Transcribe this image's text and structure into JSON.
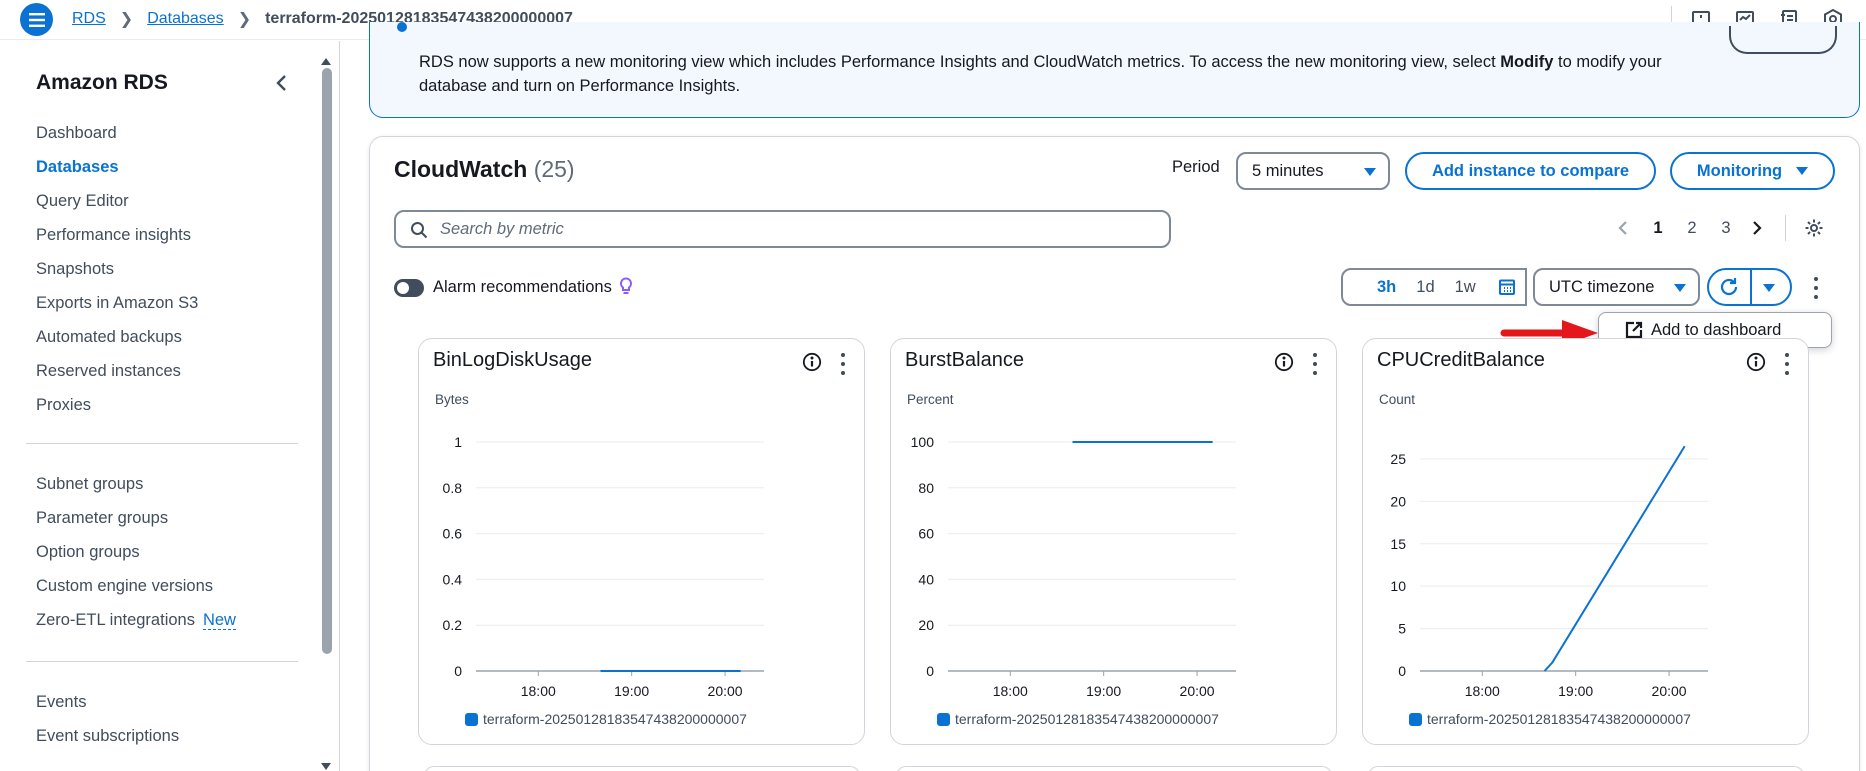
{
  "breadcrumb": {
    "items": [
      "RDS",
      "Databases"
    ],
    "current": "terraform-20250128183547438200000007"
  },
  "sidebar": {
    "title": "Amazon RDS",
    "group1": [
      "Dashboard",
      "Databases",
      "Query Editor",
      "Performance insights",
      "Snapshots",
      "Exports in Amazon S3",
      "Automated backups",
      "Reserved instances",
      "Proxies"
    ],
    "active": "Databases",
    "group2": [
      "Subnet groups",
      "Parameter groups",
      "Option groups",
      "Custom engine versions",
      "Zero-ETL integrations"
    ],
    "new_badge": "New",
    "group3": [
      "Events",
      "Event subscriptions"
    ]
  },
  "banner": {
    "text_before": "RDS now supports a new monitoring view which includes Performance Insights and CloudWatch metrics. To access the new monitoring view, select ",
    "text_bold": "Modify",
    "text_after": " to modify your database and turn on Performance Insights."
  },
  "cloudwatch": {
    "title": "CloudWatch",
    "count": "(25)",
    "period_label": "Period",
    "period_value": "5 minutes",
    "add_compare": "Add instance to compare",
    "monitoring": "Monitoring",
    "search_placeholder": "Search by metric",
    "pages": [
      "1",
      "2",
      "3"
    ],
    "current_page": "1",
    "alarm_label": "Alarm recommendations",
    "ranges": [
      "3h",
      "1d",
      "1w"
    ],
    "selected_range": "3h",
    "timezone": "UTC timezone",
    "popover_label": "Add to dashboard"
  },
  "colors": {
    "accent": "#0972d3",
    "series": "#0972d3",
    "annotation_arrow": "#e3171c",
    "alarm_bulb": "#8b5cf6"
  },
  "chart_data": [
    {
      "type": "line",
      "title": "BinLogDiskUsage",
      "ylabel": "Bytes",
      "yticks": [
        "1",
        "0.8",
        "0.6",
        "0.4",
        "0.2",
        "0"
      ],
      "ylim": [
        0,
        1
      ],
      "xticks": [
        "18:00",
        "19:00",
        "20:00"
      ],
      "xlim": [
        "17:20",
        "20:25"
      ],
      "series": [
        {
          "name": "terraform-20250128183547438200000007",
          "x": [
            "18:40",
            "20:10"
          ],
          "values": [
            0,
            0
          ]
        }
      ]
    },
    {
      "type": "line",
      "title": "BurstBalance",
      "ylabel": "Percent",
      "yticks": [
        "100",
        "80",
        "60",
        "40",
        "20",
        "0"
      ],
      "ylim": [
        0,
        100
      ],
      "xticks": [
        "18:00",
        "19:00",
        "20:00"
      ],
      "xlim": [
        "17:20",
        "20:25"
      ],
      "series": [
        {
          "name": "terraform-20250128183547438200000007",
          "x": [
            "18:40",
            "20:10"
          ],
          "values": [
            100,
            100
          ]
        }
      ]
    },
    {
      "type": "line",
      "title": "CPUCreditBalance",
      "ylabel": "Count",
      "yticks": [
        "25",
        "20",
        "15",
        "10",
        "5",
        "0"
      ],
      "ylim": [
        0,
        27
      ],
      "xticks": [
        "18:00",
        "19:00",
        "20:00"
      ],
      "xlim": [
        "17:20",
        "20:25"
      ],
      "series": [
        {
          "name": "terraform-20250128183547438200000007",
          "x": [
            "18:40",
            "18:45",
            "20:10"
          ],
          "values": [
            0,
            1,
            26.5
          ]
        }
      ]
    }
  ]
}
